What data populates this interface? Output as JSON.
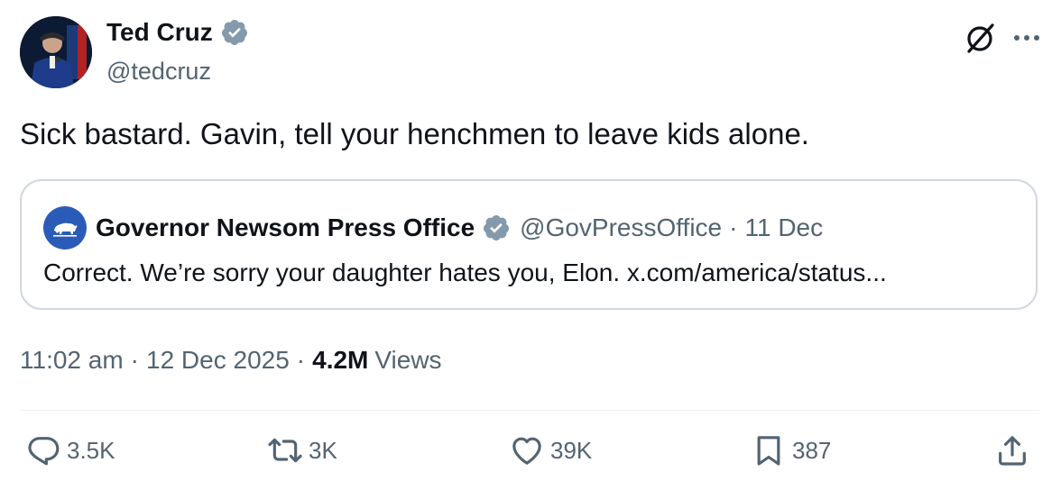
{
  "author": {
    "display_name": "Ted Cruz",
    "handle": "@tedcruz",
    "verified_icon": "verified-badge-icon"
  },
  "tweet": {
    "text": "Sick bastard. Gavin, tell your henchmen to leave kids alone."
  },
  "quoted_tweet": {
    "display_name": "Governor Newsom Press Office",
    "handle": "@GovPressOffice",
    "separator": "·",
    "date": "11 Dec",
    "text": "Correct. We’re sorry your daughter hates you, Elon. x.com/america/status..."
  },
  "meta": {
    "time": "11:02 am",
    "separator": "·",
    "date": "12 Dec 2025",
    "views_count": "4.2M",
    "views_label": "Views"
  },
  "actions": {
    "replies": "3.5K",
    "reposts": "3K",
    "likes": "39K",
    "bookmarks": "387"
  },
  "colors": {
    "text_primary": "#0f1419",
    "text_secondary": "#536471",
    "border": "#cfd9de",
    "verified_blue": "#829aab"
  }
}
